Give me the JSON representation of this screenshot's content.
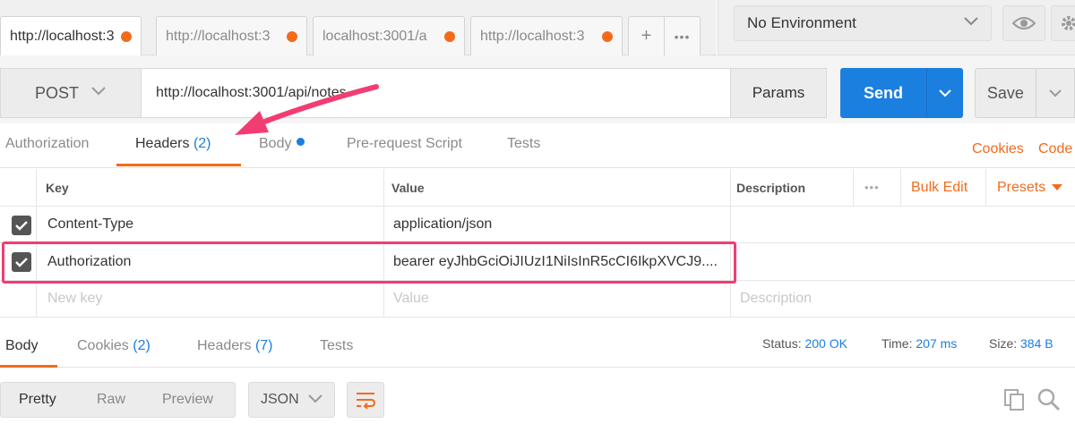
{
  "tabs": [
    {
      "label": "http://localhost:3",
      "active": true
    },
    {
      "label": "http://localhost:3",
      "active": false
    },
    {
      "label": "localhost:3001/a",
      "active": false
    },
    {
      "label": "http://localhost:3",
      "active": false
    }
  ],
  "tab_actions": {
    "add": "+",
    "more": "•••"
  },
  "environment": {
    "selected": "No Environment"
  },
  "request": {
    "method": "POST",
    "url": "http://localhost:3001/api/notes",
    "params_label": "Params",
    "send_label": "Send",
    "save_label": "Save"
  },
  "request_tabs": {
    "authorization": "Authorization",
    "headers": "Headers",
    "headers_count": "(2)",
    "body": "Body",
    "prerequest": "Pre-request Script",
    "tests": "Tests",
    "cookies": "Cookies",
    "code": "Code"
  },
  "headers_table": {
    "columns": {
      "key": "Key",
      "value": "Value",
      "description": "Description"
    },
    "more": "•••",
    "bulk_edit": "Bulk Edit",
    "presets": "Presets",
    "rows": [
      {
        "key": "Content-Type",
        "value": "application/json",
        "checked": true
      },
      {
        "key": "Authorization",
        "value": "bearer eyJhbGciOiJIUzI1NiIsInR5cCI6IkpXVCJ9....",
        "checked": true
      }
    ],
    "new_row": {
      "key": "New key",
      "value": "Value",
      "description": "Description"
    }
  },
  "response": {
    "tabs": {
      "body": "Body",
      "cookies": "Cookies",
      "cookies_count": "(2)",
      "headers": "Headers",
      "headers_count": "(7)",
      "tests": "Tests"
    },
    "status_label": "Status:",
    "status_value": "200 OK",
    "time_label": "Time:",
    "time_value": "207 ms",
    "size_label": "Size:",
    "size_value": "384 B",
    "view_modes": [
      "Pretty",
      "Raw",
      "Preview"
    ],
    "format": "JSON"
  },
  "colors": {
    "accent": "#f26b1d",
    "primary": "#1b7fe0",
    "highlight": "#f23d72"
  }
}
